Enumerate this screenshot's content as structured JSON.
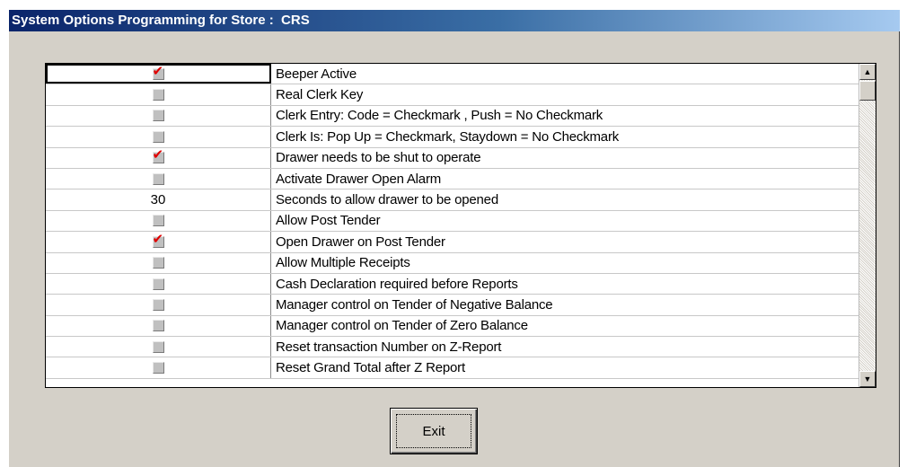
{
  "window": {
    "title": "System Options Programming for Store :  CRS"
  },
  "options": [
    {
      "value_type": "check",
      "checked": true,
      "label": "Beeper Active",
      "selected": true
    },
    {
      "value_type": "check",
      "checked": false,
      "label": "Real Clerk Key"
    },
    {
      "value_type": "check",
      "checked": false,
      "label": "Clerk Entry:  Code = Checkmark , Push = No Checkmark"
    },
    {
      "value_type": "check",
      "checked": false,
      "label": "Clerk Is:  Pop Up = Checkmark,  Staydown = No Checkmark"
    },
    {
      "value_type": "check",
      "checked": true,
      "label": "Drawer needs to be shut to operate"
    },
    {
      "value_type": "check",
      "checked": false,
      "label": "Activate Drawer Open Alarm"
    },
    {
      "value_type": "number",
      "value": "30",
      "label": "Seconds to allow drawer to be opened"
    },
    {
      "value_type": "check",
      "checked": false,
      "label": "Allow Post Tender"
    },
    {
      "value_type": "check",
      "checked": true,
      "label": "Open Drawer on Post Tender"
    },
    {
      "value_type": "check",
      "checked": false,
      "label": "Allow Multiple Receipts"
    },
    {
      "value_type": "check",
      "checked": false,
      "label": "Cash Declaration required before Reports"
    },
    {
      "value_type": "check",
      "checked": false,
      "label": "Manager control on Tender of Negative Balance"
    },
    {
      "value_type": "check",
      "checked": false,
      "label": "Manager control on Tender of Zero Balance"
    },
    {
      "value_type": "check",
      "checked": false,
      "label": "Reset transaction Number on Z-Report"
    },
    {
      "value_type": "check",
      "checked": false,
      "label": "Reset Grand Total after Z Report"
    }
  ],
  "check_mark_glyph": "✔",
  "check_mark_color": "#e00000",
  "scrollbar": {
    "up_icon": "scroll-up-arrow-icon",
    "down_icon": "scroll-down-arrow-icon",
    "up_glyph": "▲",
    "down_glyph": "▼"
  },
  "exit_button": {
    "label": "Exit"
  }
}
